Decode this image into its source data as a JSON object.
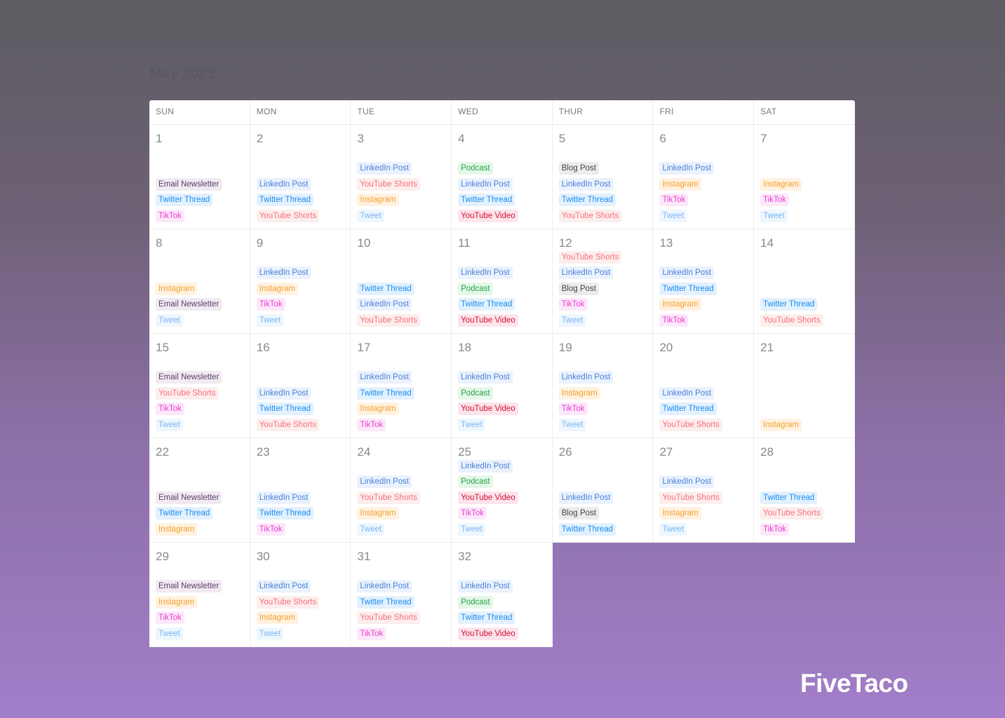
{
  "title": "May 2023",
  "logo": "FiveTaco",
  "weekdays": [
    "SUN",
    "MON",
    "TUE",
    "WED",
    "THUR",
    "FRI",
    "SAT"
  ],
  "tag_colors": {
    "Email Newsletter": {
      "text": "#5a3d6e",
      "bg": "#f1ebf1"
    },
    "LinkedIn Post": {
      "text": "#4a7fd9",
      "bg": "#eaf2fd"
    },
    "Twitter Thread": {
      "text": "#1a8cf0",
      "bg": "#e3f1fe"
    },
    "TikTok": {
      "text": "#e83bd0",
      "bg": "#fde8fa"
    },
    "YouTube Shorts": {
      "text": "#f7707b",
      "bg": "#fdeeee"
    },
    "Instagram": {
      "text": "#f5a030",
      "bg": "#fff2e0"
    },
    "Tweet": {
      "text": "#7ab6f5",
      "bg": "#eef6fe"
    },
    "Podcast": {
      "text": "#22a445",
      "bg": "#e5f7e9"
    },
    "Blog Post": {
      "text": "#444444",
      "bg": "#ececec"
    },
    "YouTube Video": {
      "text": "#d0103a",
      "bg": "#fde4ea"
    }
  },
  "weeks": [
    [
      {
        "day": "1",
        "tags": [
          "Email Newsletter",
          "Twitter Thread",
          "TikTok"
        ]
      },
      {
        "day": "2",
        "tags": [
          "LinkedIn Post",
          "Twitter Thread",
          "YouTube Shorts"
        ]
      },
      {
        "day": "3",
        "tags": [
          "LinkedIn Post",
          "YouTube Shorts",
          "Instagram",
          "Tweet"
        ]
      },
      {
        "day": "4",
        "tags": [
          "Podcast",
          "LinkedIn Post",
          "Twitter Thread",
          "YouTube Video"
        ]
      },
      {
        "day": "5",
        "tags": [
          "Blog Post",
          "LinkedIn Post",
          "Twitter Thread",
          "YouTube Shorts"
        ]
      },
      {
        "day": "6",
        "tags": [
          "LinkedIn Post",
          "Instagram",
          "TikTok",
          "Tweet"
        ]
      },
      {
        "day": "7",
        "tags": [
          "Instagram",
          "TikTok",
          "Tweet"
        ]
      }
    ],
    [
      {
        "day": "8",
        "tags": [
          "Instagram",
          "Email Newsletter",
          "Tweet"
        ]
      },
      {
        "day": "9",
        "tags": [
          "LinkedIn Post",
          "Instagram",
          "TikTok",
          "Tweet"
        ]
      },
      {
        "day": "10",
        "tags": [
          "Twitter Thread",
          "LinkedIn Post",
          "YouTube Shorts"
        ]
      },
      {
        "day": "11",
        "tags": [
          "LinkedIn Post",
          "Podcast",
          "Twitter Thread",
          "YouTube Video"
        ]
      },
      {
        "day": "12",
        "tags": [
          "YouTube Shorts",
          "LinkedIn Post",
          "Blog Post",
          "TikTok",
          "Tweet"
        ]
      },
      {
        "day": "13",
        "tags": [
          "LinkedIn Post",
          "Twitter Thread",
          "Instagram",
          "TikTok"
        ]
      },
      {
        "day": "14",
        "tags": [
          "Twitter Thread",
          "YouTube Shorts"
        ]
      }
    ],
    [
      {
        "day": "15",
        "tags": [
          "Email Newsletter",
          "YouTube Shorts",
          "TikTok",
          "Tweet"
        ]
      },
      {
        "day": "16",
        "tags": [
          "LinkedIn Post",
          "Twitter Thread",
          "YouTube Shorts"
        ]
      },
      {
        "day": "17",
        "tags": [
          "LinkedIn Post",
          "Twitter Thread",
          "Instagram",
          "TikTok"
        ]
      },
      {
        "day": "18",
        "tags": [
          "LinkedIn Post",
          "Podcast",
          "YouTube Video",
          "Tweet"
        ]
      },
      {
        "day": "19",
        "tags": [
          "LinkedIn Post",
          "Instagram",
          "TikTok",
          "Tweet"
        ]
      },
      {
        "day": "20",
        "tags": [
          "LinkedIn Post",
          "Twitter Thread",
          "YouTube Shorts"
        ]
      },
      {
        "day": "21",
        "tags": [
          "Instagram"
        ]
      }
    ],
    [
      {
        "day": "22",
        "tags": [
          "Email Newsletter",
          "Twitter Thread",
          "Instagram"
        ]
      },
      {
        "day": "23",
        "tags": [
          "LinkedIn Post",
          "Twitter Thread",
          "TikTok"
        ]
      },
      {
        "day": "24",
        "tags": [
          "LinkedIn Post",
          "YouTube Shorts",
          "Instagram",
          "Tweet"
        ]
      },
      {
        "day": "25",
        "tags": [
          "LinkedIn Post",
          "Podcast",
          "YouTube Video",
          "TikTok",
          "Tweet"
        ]
      },
      {
        "day": "26",
        "tags": [
          "LinkedIn Post",
          "Blog Post",
          "Twitter Thread"
        ]
      },
      {
        "day": "27",
        "tags": [
          "LinkedIn Post",
          "YouTube Shorts",
          "Instagram",
          "Tweet"
        ]
      },
      {
        "day": "28",
        "tags": [
          "Twitter Thread",
          "YouTube Shorts",
          "TikTok"
        ]
      }
    ],
    [
      {
        "day": "29",
        "tags": [
          "Email Newsletter",
          "Instagram",
          "TikTok",
          "Tweet"
        ]
      },
      {
        "day": "30",
        "tags": [
          "LinkedIn Post",
          "YouTube Shorts",
          "Instagram",
          "Tweet"
        ]
      },
      {
        "day": "31",
        "tags": [
          "LinkedIn Post",
          "Twitter Thread",
          "YouTube Shorts",
          "TikTok"
        ]
      },
      {
        "day": "32",
        "tags": [
          "LinkedIn Post",
          "Podcast",
          "Twitter Thread",
          "YouTube Video"
        ]
      }
    ]
  ]
}
